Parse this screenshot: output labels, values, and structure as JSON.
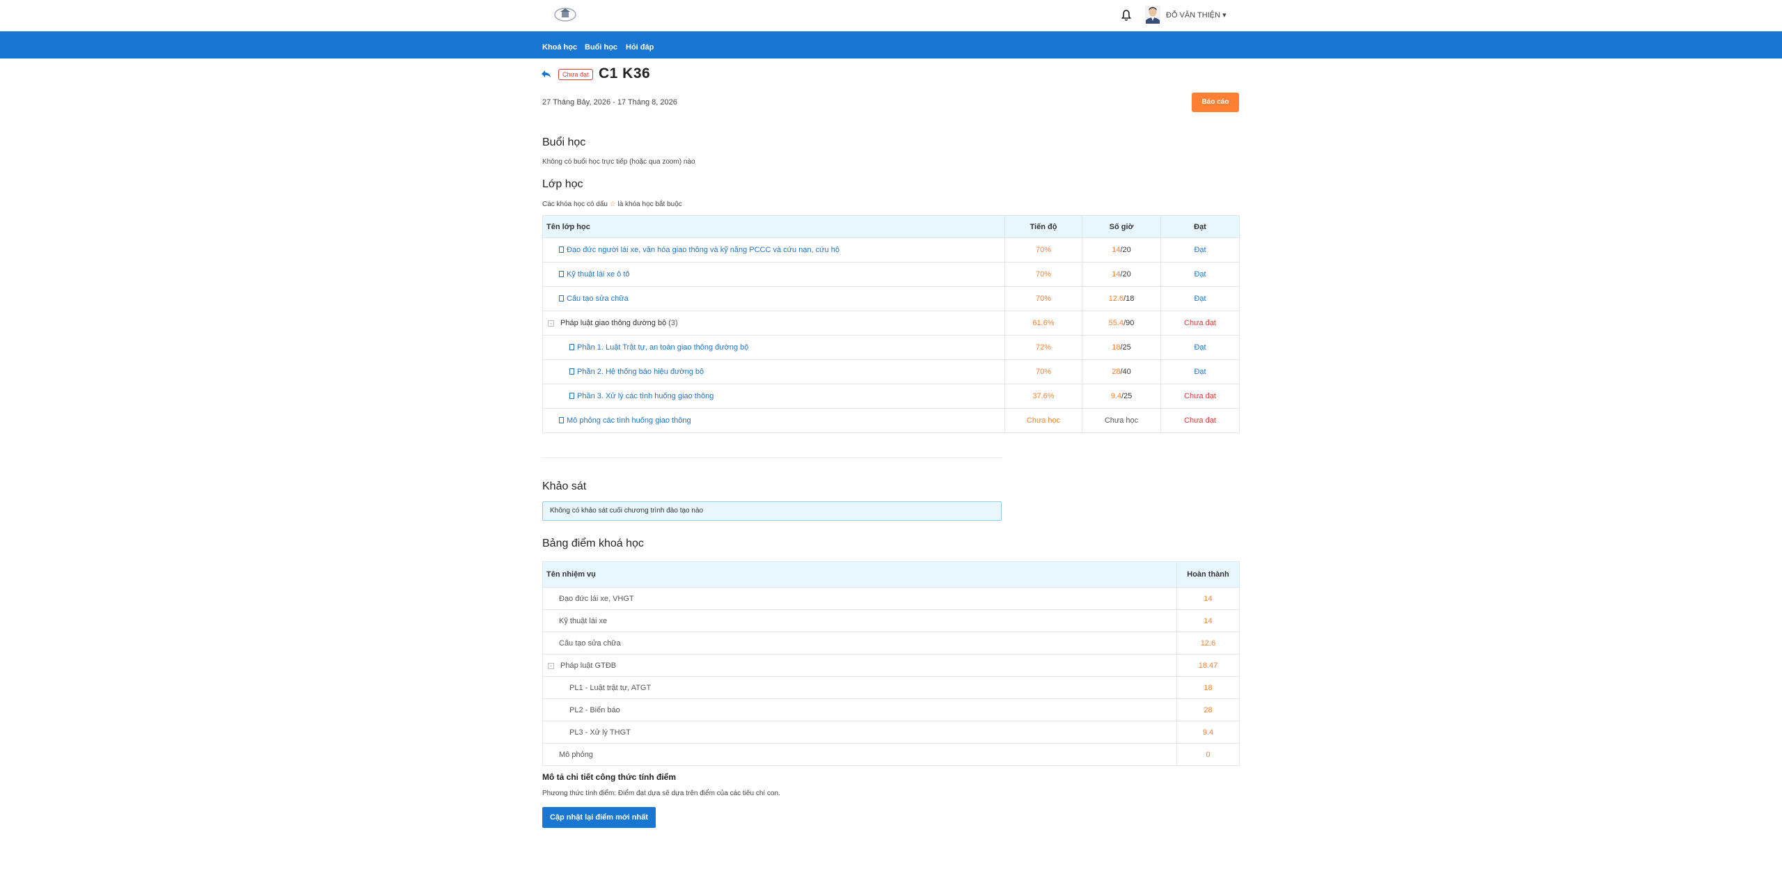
{
  "header": {
    "user_name": "ĐỖ VĂN THIỆN ▾"
  },
  "nav": {
    "items": [
      "Khoá học",
      "Buổi học",
      "Hỏi đáp"
    ]
  },
  "course": {
    "status": "Chưa đạt",
    "title": "C1 K36",
    "date_range": "27 Tháng Bảy, 2026 - 17 Tháng 8, 2026",
    "report_label": "Báo cáo"
  },
  "sessions": {
    "title": "Buổi học",
    "empty_text": "Không có buổi học trực tiếp (hoặc qua zoom) nào"
  },
  "classes": {
    "title": "Lớp học",
    "note_before": "Các khóa học có dấu",
    "note_star": "☆",
    "note_after": "là khóa học bắt buộc",
    "headers": [
      "Tên lớp học",
      "Tiến độ",
      "Số giờ",
      "Đạt"
    ],
    "rows": [
      {
        "name": "Đạo đức người lái xe, văn hóa giao thông và kỹ năng PCCC và cứu nạn, cứu hộ",
        "progress": "70%",
        "hours_done": "14",
        "hours_total": "/20",
        "status": "Đạt"
      },
      {
        "name": "Kỹ thuật lái xe ô tô",
        "progress": "70%",
        "hours_done": "14",
        "hours_total": "/20",
        "status": "Đạt"
      },
      {
        "name": "Cấu tạo sửa chữa",
        "progress": "70%",
        "hours_done": "12.6",
        "hours_total": "/18",
        "status": "Đạt"
      },
      {
        "name": "Pháp luật giao thông đường bộ",
        "count": "(3)",
        "progress": "61.6%",
        "hours_done": "55.4",
        "hours_total": "/90",
        "status": "Chưa đạt"
      },
      {
        "name": "Phần 1. Luật Trật tự, an toàn giao thông đường bộ",
        "progress": "72%",
        "hours_done": "18",
        "hours_total": "/25",
        "status": "Đạt"
      },
      {
        "name": "Phần 2. Hệ thống báo hiệu đường bộ",
        "progress": "70%",
        "hours_done": "28",
        "hours_total": "/40",
        "status": "Đạt"
      },
      {
        "name": "Phần 3. Xử lý các tình huống giao thông",
        "progress": "37.6%",
        "hours_done": "9.4",
        "hours_total": "/25",
        "status": "Chưa đạt"
      },
      {
        "name": "Mô phỏng các tình huống giao thông",
        "progress": "Chưa học",
        "hours_text": "Chưa học",
        "status": "Chưa đạt"
      }
    ]
  },
  "survey": {
    "title": "Khảo sát",
    "empty_text": "Không có khảo sát cuối chương trình đào tạo nào"
  },
  "grades": {
    "title": "Bảng điểm khoá học",
    "headers": [
      "Tên nhiệm vụ",
      "Hoàn thành"
    ],
    "rows": [
      {
        "name": "Đạo đức lái xe, VHGT",
        "score": "14"
      },
      {
        "name": "Kỹ thuật lái xe",
        "score": "14"
      },
      {
        "name": "Cấu tạo sửa chữa",
        "score": "12.6"
      },
      {
        "name": "Pháp luật GTĐB",
        "score": "18.47"
      },
      {
        "name": "PL1 - Luật trật tự, ATGT",
        "score": "18"
      },
      {
        "name": "PL2 - Biển báo",
        "score": "28"
      },
      {
        "name": "PL3 - Xử lý THGT",
        "score": "9.4"
      },
      {
        "name": "Mô phỏng",
        "score": "0"
      }
    ]
  },
  "formula": {
    "title": "Mô tả chi tiết công thức tính điểm",
    "text": "Phương thức tính điểm: Điểm đạt dựa sẽ dựa trên điểm của các tiêu chí con.",
    "update_label": "Cập nhật lại điểm mới nhất"
  },
  "colors": {
    "nav_blue": "#1976d2",
    "accent_orange": "#ff7f32",
    "fail_red": "#e53935",
    "pass_blue": "#1f73c7",
    "header_bg": "#e8f6fd"
  },
  "icons": [
    "logo",
    "bell-icon",
    "avatar",
    "back-arrow-icon",
    "document-icon",
    "collapse-icon"
  ]
}
